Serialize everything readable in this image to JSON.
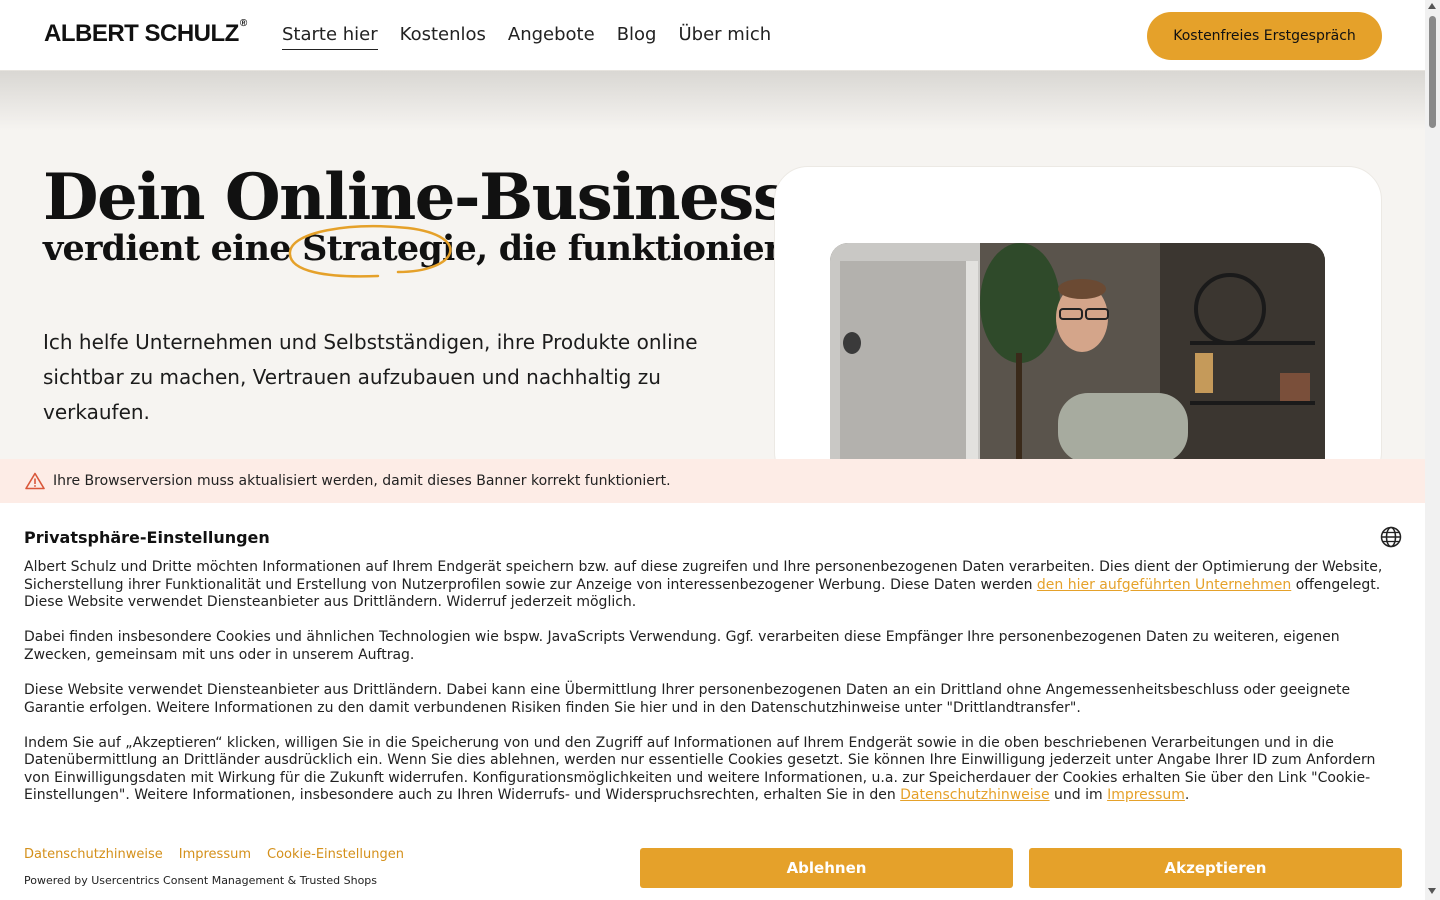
{
  "header": {
    "logo": "ALBERT SCHULZ",
    "logo_mark": "®",
    "nav": [
      {
        "label": "Starte hier",
        "active": true
      },
      {
        "label": "Kostenlos"
      },
      {
        "label": "Angebote"
      },
      {
        "label": "Blog"
      },
      {
        "label": "Über mich"
      }
    ],
    "cta_label": "Kostenfreies Erstgespräch"
  },
  "hero": {
    "title": "Dein Online-Business",
    "subtitle_before": "verdient eine ",
    "subtitle_highlight": "Strategie,",
    "subtitle_after": " die funktioniert.",
    "lead": "Ich helfe Unternehmen und Selbstständigen, ihre Produkte online sichtbar zu machen, Vertrauen aufzubauen und nachhaltig zu verkaufen."
  },
  "consent": {
    "warning": "Ihre Browserversion muss aktualisiert werden, damit dieses Banner korrekt funktioniert.",
    "title": "Privatsphäre-Einstellungen",
    "p1_before": "Albert Schulz und Dritte möchten Informationen auf Ihrem Endgerät speichern bzw. auf diese zugreifen und Ihre personenbezogenen Daten verarbeiten. Dies dient der Optimierung der Website, Sicherstellung ihrer Funktionalität und Erstellung von Nutzerprofilen sowie zur Anzeige von interessenbezogener Werbung. Diese Daten werden ",
    "p1_link": "den hier aufgeführten Unternehmen",
    "p1_after": " offengelegt. Diese Website verwendet Diensteanbieter aus Drittländern. Widerruf jederzeit möglich.",
    "p2": "Dabei finden insbesondere Cookies und ähnlichen Technologien wie bspw. JavaScripts Verwendung. Ggf. verarbeiten diese Empfänger Ihre personenbezogenen Daten zu weiteren, eigenen Zwecken, gemeinsam mit uns oder in unserem Auftrag.",
    "p3": "Diese Website verwendet Diensteanbieter aus Drittländern. Dabei kann eine Übermittlung Ihrer personenbezogenen Daten an ein Drittland ohne Angemessenheitsbeschluss oder geeignete Garantie erfolgen. Weitere Informationen zu den damit verbundenen Risiken finden Sie hier und in den Datenschutzhinweise unter \"Drittlandtransfer\".",
    "p4_before": "Indem Sie auf „Akzeptieren“ klicken, willigen Sie in die Speicherung von und den Zugriff auf Informationen auf Ihrem Endgerät sowie in die oben beschriebenen Verarbeitungen und in die Datenübermittlung an Drittländer ausdrücklich ein. Wenn Sie dies ablehnen, werden nur essentielle Cookies gesetzt. Sie können Ihre Einwilligung jederzeit unter Angabe Ihrer ID zum Anfordern von Einwilligungsdaten mit Wirkung für die Zukunft widerrufen. Konfigurationsmöglichkeiten und weitere Informationen, u.a. zur Speicherdauer der Cookies erhalten Sie über den Link \"Cookie-Einstellungen\". Weitere Informationen, insbesondere auch zu Ihren Widerrufs- und Widerspruchsrechten, erhalten Sie in den ",
    "p4_link1": "Datenschutzhinweise",
    "p4_mid": " und im ",
    "p4_link2": "Impressum",
    "p4_after": ".",
    "links": [
      "Datenschutzhinweise",
      "Impressum",
      "Cookie-Einstellungen"
    ],
    "powered_by": "Powered by Usercentrics Consent Management & Trusted Shops",
    "decline_label": "Ablehnen",
    "accept_label": "Akzeptieren"
  },
  "colors": {
    "accent": "#e5a12a",
    "warning_bg": "#fdece6",
    "warning_icon": "#d9573a",
    "page_bg": "#f6f4f1"
  },
  "icons": [
    "warning-triangle-icon",
    "globe-icon"
  ]
}
